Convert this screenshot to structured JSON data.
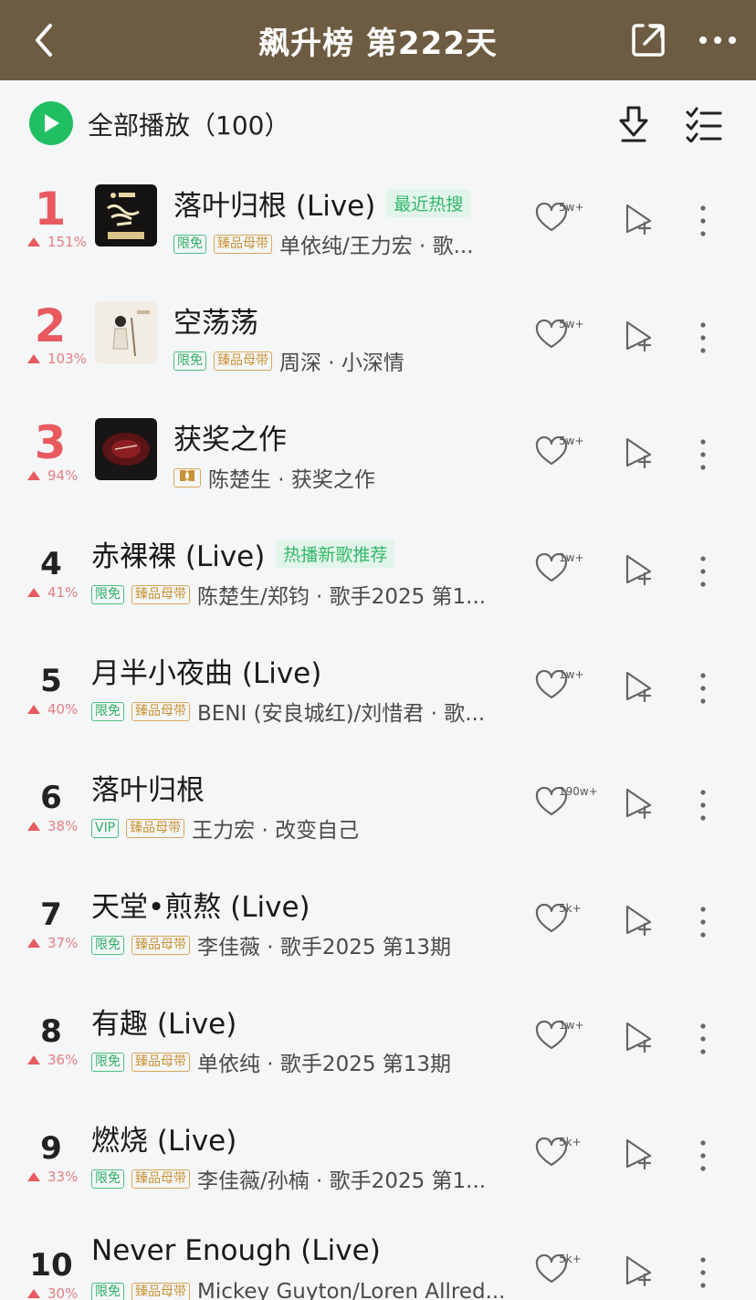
{
  "header": {
    "title": "飙升榜 第222天"
  },
  "playbar": {
    "label": "全部播放（100）"
  },
  "colors": {
    "header_bg": "#6d5c42",
    "play_green": "#1fbf62",
    "rank_red": "#e85a5f",
    "hot_tag_green": "#33b86b"
  },
  "icons": [
    "back-icon",
    "share-icon",
    "more-icon",
    "play-icon",
    "download-icon",
    "multi-select-icon",
    "heart-icon",
    "add-to-playlist-icon",
    "row-more-icon"
  ],
  "songs": [
    {
      "rank": "1",
      "change": "151%",
      "title": "落叶归根 (Live)",
      "hot_tag": "最近热搜",
      "badges": [
        "限免",
        "臻品母带"
      ],
      "meta": "单依纯/王力宏 · 歌...",
      "likes": "5w+",
      "has_cover": true
    },
    {
      "rank": "2",
      "change": "103%",
      "title": "空荡荡",
      "hot_tag": "",
      "badges": [
        "限免",
        "臻品母带"
      ],
      "meta": "周深 · 小深情",
      "likes": "5w+",
      "has_cover": true
    },
    {
      "rank": "3",
      "change": "94%",
      "title": "获奖之作",
      "hot_tag": "",
      "badges": [
        "dolby"
      ],
      "meta": "陈楚生 · 获奖之作",
      "likes": "5w+",
      "has_cover": true
    },
    {
      "rank": "4",
      "change": "41%",
      "title": "赤裸裸 (Live)",
      "hot_tag": "热播新歌推荐",
      "badges": [
        "限免",
        "臻品母带"
      ],
      "meta": "陈楚生/郑钧 · 歌手2025 第1...",
      "likes": "1w+",
      "has_cover": false
    },
    {
      "rank": "5",
      "change": "40%",
      "title": "月半小夜曲 (Live)",
      "hot_tag": "",
      "badges": [
        "限免",
        "臻品母带"
      ],
      "meta": "BENI (安良城红)/刘惜君 · 歌...",
      "likes": "1w+",
      "has_cover": false
    },
    {
      "rank": "6",
      "change": "38%",
      "title": "落叶归根",
      "hot_tag": "",
      "badges": [
        "VIP",
        "臻品母带"
      ],
      "meta": "王力宏 · 改变自己",
      "likes": "190w+",
      "has_cover": false
    },
    {
      "rank": "7",
      "change": "37%",
      "title": "天堂•煎熬 (Live)",
      "hot_tag": "",
      "badges": [
        "限免",
        "臻品母带"
      ],
      "meta": "李佳薇 · 歌手2025 第13期",
      "likes": "5k+",
      "has_cover": false
    },
    {
      "rank": "8",
      "change": "36%",
      "title": "有趣 (Live)",
      "hot_tag": "",
      "badges": [
        "限免",
        "臻品母带"
      ],
      "meta": "单依纯 · 歌手2025 第13期",
      "likes": "1w+",
      "has_cover": false
    },
    {
      "rank": "9",
      "change": "33%",
      "title": "燃烧 (Live)",
      "hot_tag": "",
      "badges": [
        "限免",
        "臻品母带"
      ],
      "meta": "李佳薇/孙楠 · 歌手2025 第1...",
      "likes": "5k+",
      "has_cover": false
    },
    {
      "rank": "10",
      "change": "30%",
      "title": "Never Enough (Live)",
      "hot_tag": "",
      "badges": [
        "限免",
        "臻品母带"
      ],
      "meta": "Mickey Guyton/Loren Allred...",
      "likes": "5k+",
      "has_cover": false
    }
  ]
}
